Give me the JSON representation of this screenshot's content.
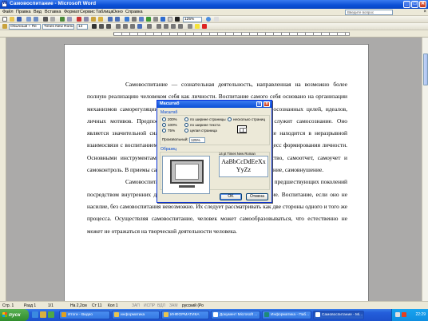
{
  "window": {
    "title": "Самовоспитание - Microsoft Word",
    "minimize": "_",
    "maximize": "□",
    "close": "✕"
  },
  "menu": {
    "items": [
      "Файл",
      "Правка",
      "Вид",
      "Вставка",
      "Формат",
      "Сервис",
      "Таблица",
      "Окно",
      "Справка"
    ],
    "help_placeholder": "Введите вопрос",
    "doc_close": "×"
  },
  "toolbar": {
    "zoom": "125%",
    "style": "Обычный + Пе",
    "font": "Times New Roman",
    "size": "14"
  },
  "document": {
    "paragraphs": [
      "Самовоспитание — сознательная деятельность, направленная на возможно более полную реализацию человеком себя как личности. Воспитание самого себя основано на организации механизмов саморегуляции, предполагает осознание личностью ясно осознанных целей, идеалов, личных мотивов. Предпосылкой повышения степени осознанности служит самосознание. Оно является значительной силой саморазвития личности. Самовоспитание находится в неразрывной взаимосвязи с воспитанием личности, опираясь на него и развивая процесс формирования личности. Основными инструментами самовоспитания являются самообязательство, самоотчет, самоучет и самоконтроль. В приемы самовоспитания входят самоприказ, самоодобрение, самовнушение.",
      "Самовоспитание – это процесс усвоения человеком опыта предшествующих поколений посредством внутренних душевных факторов, обеспечивающих развитие. Воспитание, если оно не насилие, без самовоспитания невозможно. Их следует рассматривать как две стороны одного и того же процесса. Осуществляя самовоспитание, человек может самообразовываться, что естественно не может не отражаться на творческой деятельности человека."
    ]
  },
  "dialog": {
    "title": "Масштаб",
    "help": "?",
    "close": "x",
    "group_label": "Масштаб",
    "options": [
      {
        "label": "200%",
        "selected": false
      },
      {
        "label": "100%",
        "selected": false
      },
      {
        "label": "75%",
        "selected": false
      },
      {
        "label": "по ширине страницы",
        "selected": false
      },
      {
        "label": "по ширине текста",
        "selected": false
      },
      {
        "label": "целая страница",
        "selected": false
      },
      {
        "label": "несколько страниц",
        "selected": false
      }
    ],
    "custom_label": "Произвольный:",
    "custom_value": "125%",
    "preview_label": "Образец",
    "font_sample_label": "14 pt Times New Roman",
    "font_sample": "AaBbCcDdEeXxYyZz",
    "ok": "OK",
    "cancel": "Отмена"
  },
  "statusbar": {
    "page": "Стр. 1",
    "section": "Разд 1",
    "pages": "1/1",
    "position": "На 2,2см",
    "line": "Ст 11",
    "column": "Кол 1",
    "rec": "ЗАП",
    "trk": "ИСПР",
    "ext": "ВДЛ",
    "ovr": "ЗАМ",
    "language": "русский (Ро"
  },
  "taskbar": {
    "start": "пуск",
    "tasks": [
      {
        "label": "Итоги - Видео",
        "active": false
      },
      {
        "label": "информатика",
        "active": false
      },
      {
        "label": "ИНФОРМАТИКА",
        "active": false
      },
      {
        "label": "Документ Microsoft ...",
        "active": false
      },
      {
        "label": "Информатика - Паб...",
        "active": false
      },
      {
        "label": "Самовоспитание - Mi...",
        "active": true
      }
    ],
    "clock": "22:29"
  },
  "colors": {
    "title_bar": "#0a4fd6",
    "taskbar": "#245edb",
    "start_button": "#3c9a36",
    "dialog_bg": "#ece9d8"
  }
}
